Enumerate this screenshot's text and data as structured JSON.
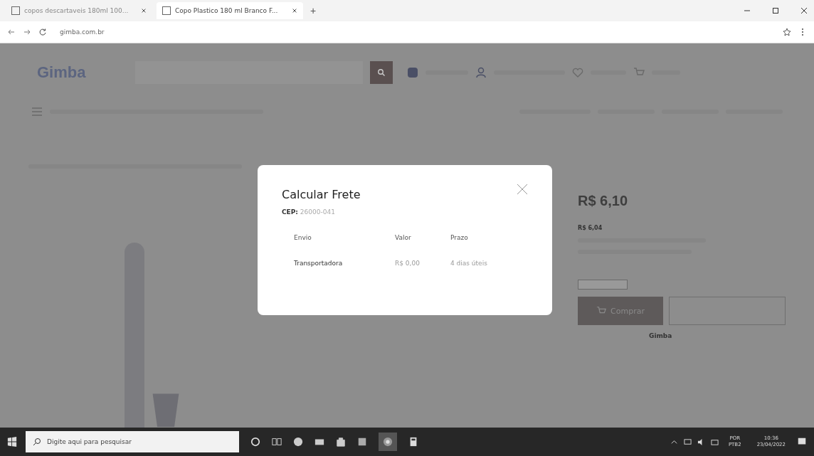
{
  "browser": {
    "tabs": [
      {
        "title": "copos descartaveis 180ml 100...",
        "selected": false
      },
      {
        "title": "Copo Plastico 180 ml Branco F...",
        "selected": true
      }
    ],
    "new_tab": "+",
    "address": "gimba.com.br"
  },
  "page": {
    "logo": "Gimba",
    "price": "R$ 6,10",
    "discount_price": "R$ 6,04",
    "buy_button": "Comprar",
    "footer_brand": "Gimba"
  },
  "modal": {
    "title": "Calcular Frete",
    "cep_label": "CEP:",
    "cep_value": "26000-041",
    "columns": [
      "Envio",
      "Valor",
      "Prazo"
    ],
    "rows": [
      [
        "Transportadora",
        "R$ 0,00",
        "4 dias úteis"
      ]
    ]
  },
  "taskbar": {
    "search_placeholder": "Digite aqui para pesquisar",
    "language": "POR",
    "layout": "PTB2",
    "time": "10:36",
    "date": "23/04/2022"
  }
}
